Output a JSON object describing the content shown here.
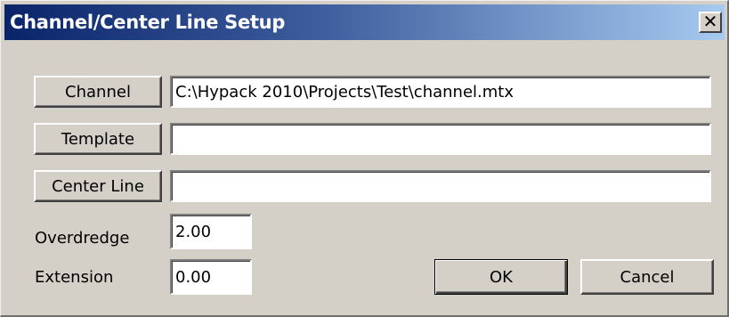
{
  "window": {
    "title": "Channel/Center Line Setup",
    "close_glyph": "✕"
  },
  "fields": {
    "channel": {
      "button_label": "Channel",
      "value": "C:\\Hypack 2010\\Projects\\Test\\channel.mtx"
    },
    "template": {
      "button_label": "Template",
      "value": ""
    },
    "center_line": {
      "button_label": "Center Line",
      "value": ""
    }
  },
  "overdredge": {
    "label": "Overdredge",
    "value": "2.00"
  },
  "extension": {
    "label": "Extension",
    "value": "0.00"
  },
  "actions": {
    "ok_label": "OK",
    "cancel_label": "Cancel"
  },
  "icons": {
    "close": "close-icon"
  }
}
